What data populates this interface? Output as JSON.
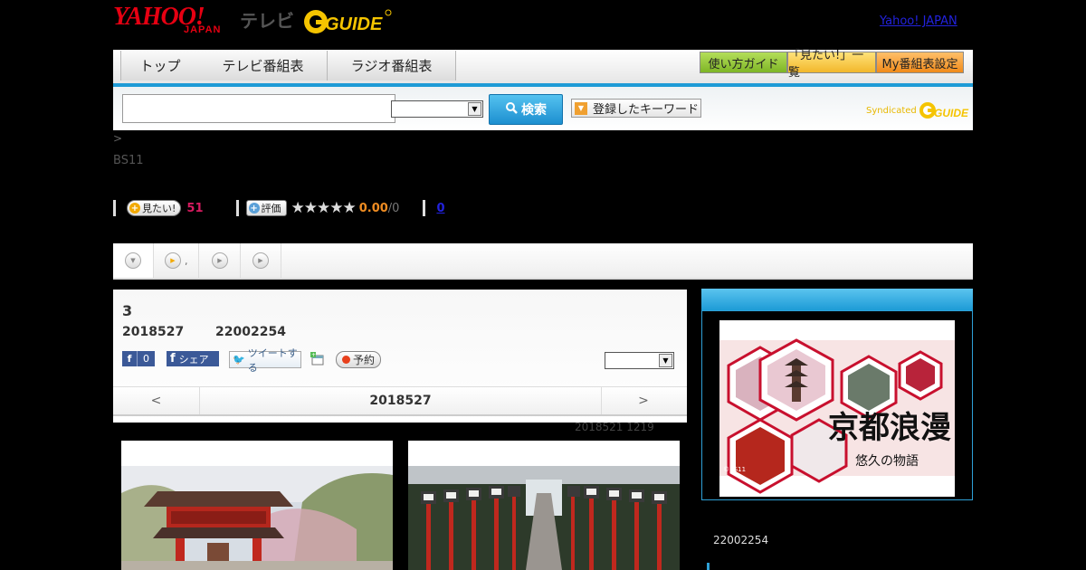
{
  "header": {
    "logo_yahoo": "YAHOO!",
    "logo_japan": "JAPAN",
    "logo_tv": "テレビ",
    "logo_gguide": "G GUIDE",
    "yahoo_japan_link": "Yahoo! JAPAN"
  },
  "nav": {
    "tabs": [
      {
        "label": "トップ"
      },
      {
        "label": "テレビ番組表"
      },
      {
        "label": "ラジオ番組表"
      }
    ],
    "buttons": [
      {
        "label": "使い方ガイド"
      },
      {
        "label": "「見たい!」一覧"
      },
      {
        "label": "My番組表設定"
      }
    ]
  },
  "search": {
    "input_value": "",
    "select_value": "",
    "button_label": "検索",
    "keyword_button_label": "登録したキーワード",
    "syndicated_label": "Syndicated",
    "syndicated_brand": "G GUIDE"
  },
  "info": {
    "breadcrumb": ">",
    "channel": "BS11",
    "want_label": "見たい!",
    "want_count": "51",
    "rate_label": "評価",
    "stars": "★★★★★",
    "rating": "0.00",
    "rating_total": "/0",
    "comment_count": "0"
  },
  "subtabs": [
    {
      "label": ""
    },
    {
      "label": ","
    },
    {
      "label": ""
    },
    {
      "label": ""
    }
  ],
  "program": {
    "title": "3",
    "date": "2018527",
    "episode_id": "22002254",
    "fb_count": "0",
    "share_label": "シェア",
    "tweet_label": "ツイートする",
    "reserve_label": "予約",
    "select_value": "",
    "prev": "<",
    "next": ">",
    "nav_date": "2018527",
    "updated": "2018521  1219"
  },
  "sidebar": {
    "image_title": "京都浪漫",
    "image_subtitle": "悠久の物語",
    "image_credit": "©BS11",
    "episode_id": "22002254"
  },
  "colors": {
    "accent_blue": "#1e9bd6",
    "yahoo_red": "#e60012",
    "want_count": "#d81b60",
    "rating": "#ef8c22"
  }
}
